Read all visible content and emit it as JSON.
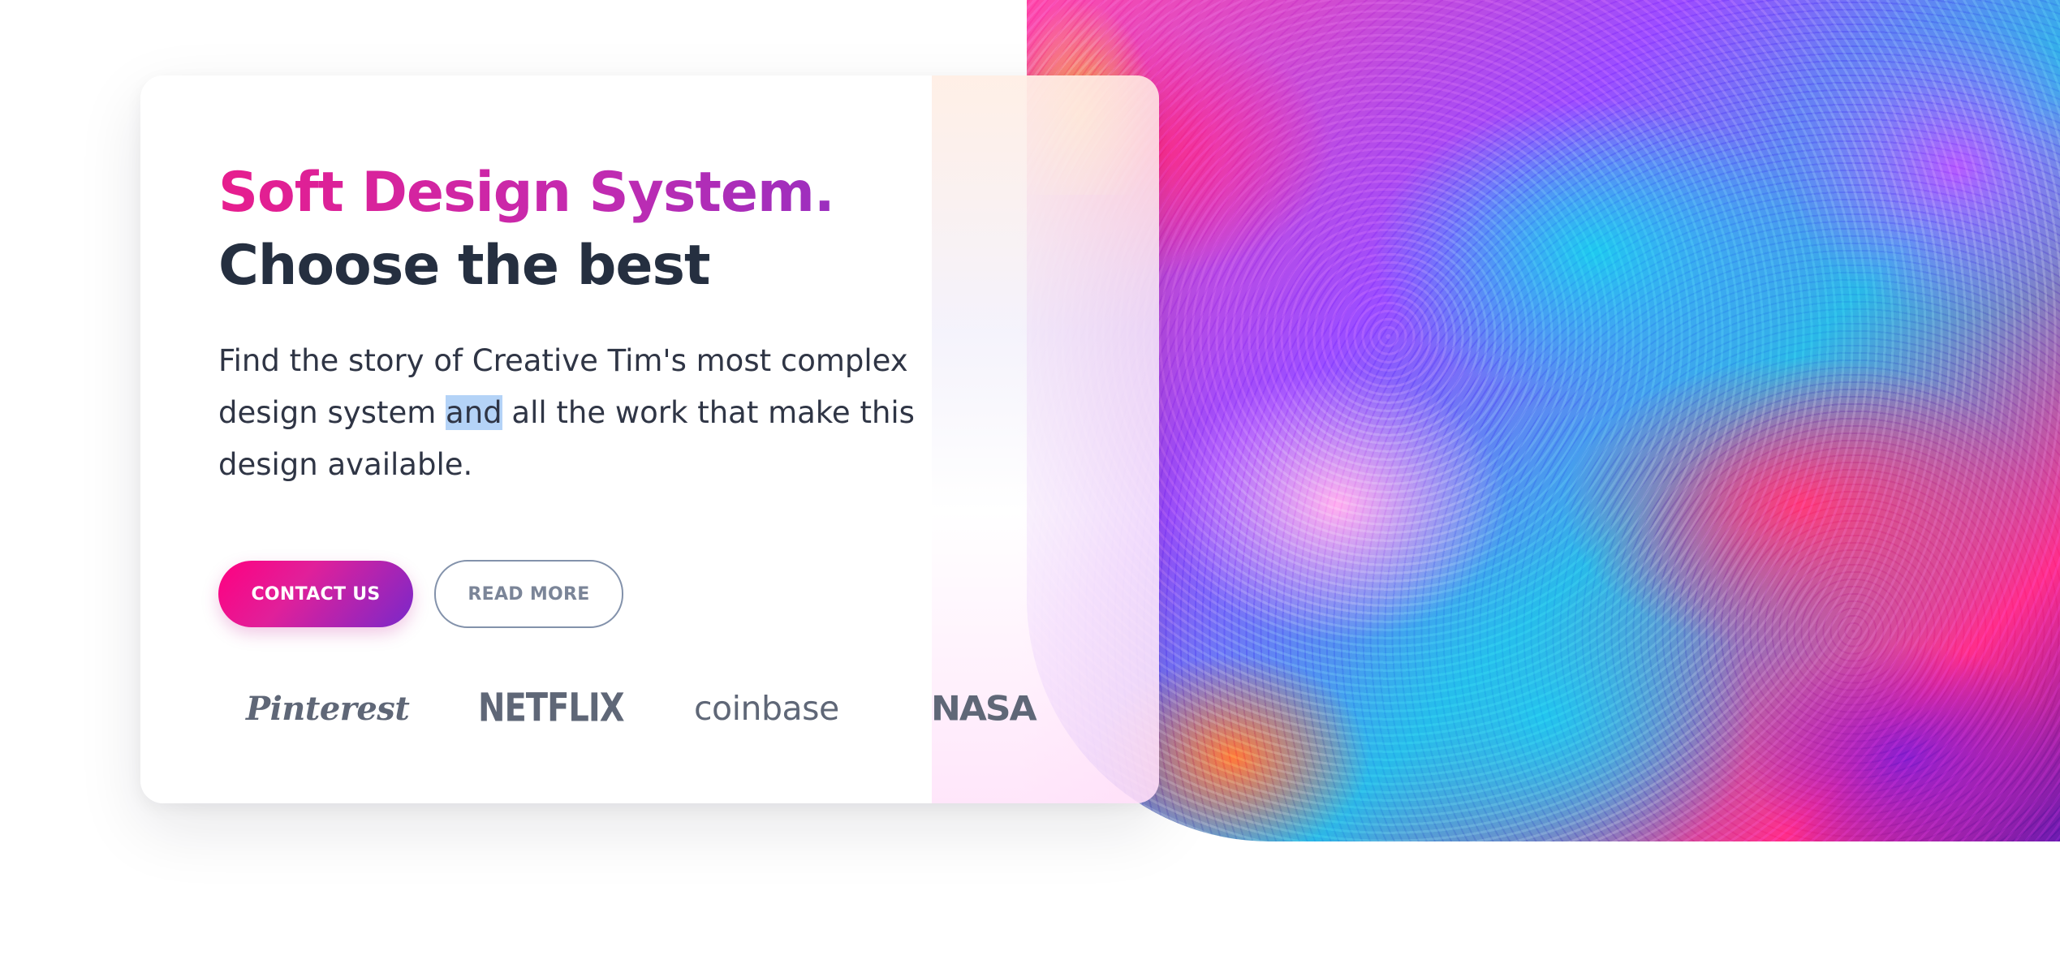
{
  "hero": {
    "title_line1": "Soft Design System.",
    "title_line2": "Choose the best",
    "description": {
      "before": "Find the story of Creative Tim's most complex design system ",
      "highlighted": "and",
      "after": " all the work that make this design available."
    },
    "primary_button": "CONTACT US",
    "secondary_button": "READ MORE"
  },
  "logos": [
    {
      "name": "Pinterest",
      "icon": "pinterest-logo"
    },
    {
      "name": "NETFLIX",
      "icon": "netflix-logo"
    },
    {
      "name": "coinbase",
      "icon": "coinbase-logo"
    },
    {
      "name": "NASA",
      "icon": "nasa-logo"
    }
  ],
  "colors": {
    "accent_gradient_start": "#ff0080",
    "accent_gradient_end": "#7928ca",
    "heading_dark": "#252f40",
    "body_text": "#2f3545",
    "muted": "#8392ab",
    "selection_highlight": "#b4d3f7"
  }
}
